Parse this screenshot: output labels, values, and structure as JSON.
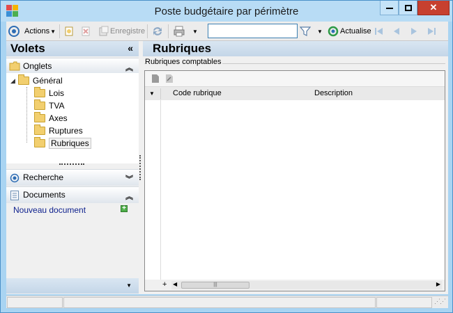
{
  "window": {
    "title": "Poste budgétaire par périmètre"
  },
  "toolbar": {
    "actions_label": "Actions",
    "save_label": "Enregistre",
    "search_value": "",
    "refresh_label": "Actualise"
  },
  "left_panel": {
    "title": "Volets",
    "onglets": {
      "title": "Onglets",
      "tree": {
        "root": "Général",
        "children": [
          "Lois",
          "TVA",
          "Axes",
          "Ruptures",
          "Rubriques"
        ],
        "selected": "Rubriques"
      }
    },
    "recherche": {
      "title": "Recherche"
    },
    "documents": {
      "title": "Documents",
      "new_document": "Nouveau document"
    }
  },
  "main": {
    "title": "Rubriques",
    "group_label": "Rubriques comptables",
    "columns": [
      "Code rubrique",
      "Description"
    ],
    "add_row_symbol": "+"
  },
  "colors": {
    "window_border": "#4a90c8",
    "header_blue": "#c9dcec",
    "folder": "#f2cf6f",
    "link": "#0b1e8c",
    "accent": "#3c7fb1"
  }
}
